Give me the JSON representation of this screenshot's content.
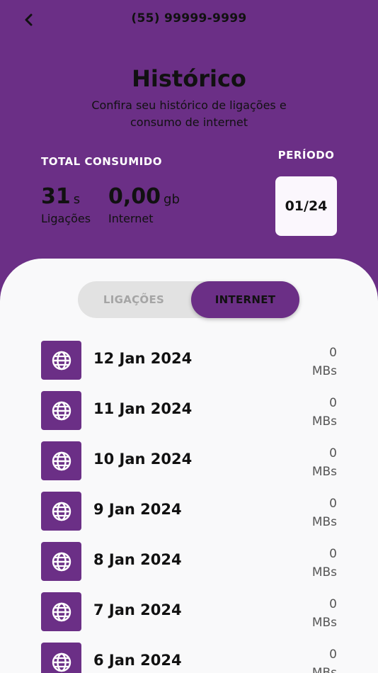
{
  "header": {
    "phone": "(55) 99999-9999",
    "title": "Histórico",
    "subtitle": "Confira seu histórico de ligações e consumo de internet"
  },
  "summary": {
    "total_label": "TOTAL CONSUMIDO",
    "calls_value": "31",
    "calls_unit": "s",
    "calls_caption": "Ligações",
    "internet_value": "0,00",
    "internet_unit": "gb",
    "internet_caption": "Internet",
    "period_label": "PERÍODO",
    "period_value": "01/24"
  },
  "tabs": {
    "calls": "LIGAÇÕES",
    "internet": "INTERNET",
    "active": "internet"
  },
  "entries": [
    {
      "date": "12 Jan 2024",
      "value": "0",
      "unit": "MBs"
    },
    {
      "date": "11 Jan 2024",
      "value": "0",
      "unit": "MBs"
    },
    {
      "date": "10 Jan 2024",
      "value": "0",
      "unit": "MBs"
    },
    {
      "date": "9 Jan 2024",
      "value": "0",
      "unit": "MBs"
    },
    {
      "date": "8 Jan 2024",
      "value": "0",
      "unit": "MBs"
    },
    {
      "date": "7 Jan 2024",
      "value": "0",
      "unit": "MBs"
    },
    {
      "date": "6 Jan 2024",
      "value": "0",
      "unit": "MBs"
    }
  ],
  "icons": {
    "back": "chevron-left-icon",
    "entry": "globe-icon"
  },
  "colors": {
    "primary": "#6b2f86",
    "sheet": "#f9f9fa",
    "toggle_bg": "#e2e2e2"
  }
}
